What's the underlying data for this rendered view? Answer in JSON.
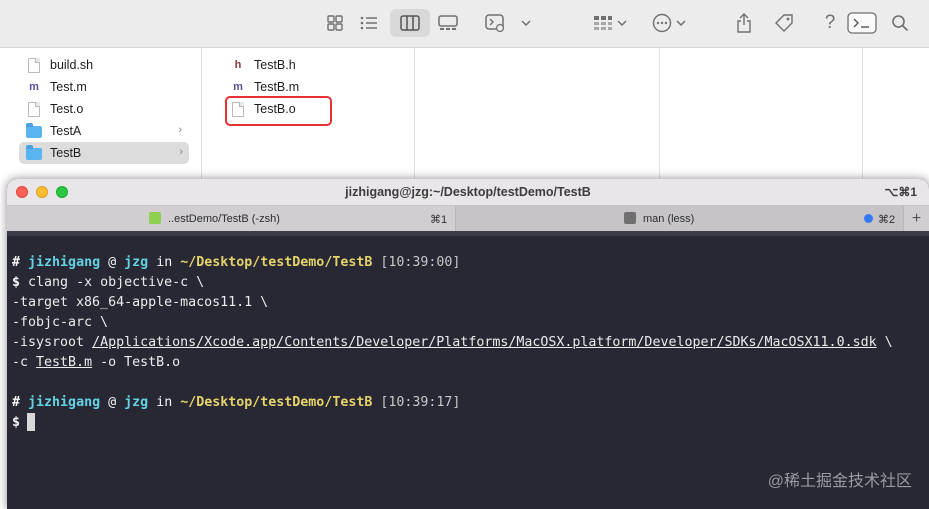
{
  "finder": {
    "column1": [
      {
        "name": "build.sh",
        "kind": "doc"
      },
      {
        "name": "Test.m",
        "kind": "m"
      },
      {
        "name": "Test.o",
        "kind": "doc"
      },
      {
        "name": "TestA",
        "kind": "folder"
      },
      {
        "name": "TestB",
        "kind": "folder",
        "selected": true
      }
    ],
    "column2": [
      {
        "name": "TestB.h",
        "kind": "h"
      },
      {
        "name": "TestB.m",
        "kind": "m"
      },
      {
        "name": "TestB.o",
        "kind": "doc",
        "highlighted": true
      }
    ],
    "glyphs": {
      "h": "h",
      "m": "m"
    },
    "colors": {
      "highlight_box": "#e8322f",
      "folder": "#5ab4f0"
    }
  },
  "terminal": {
    "title": "jizhigang@jzg:~/Desktop/testDemo/TestB",
    "window_shortcut": "⌥⌘1",
    "tabs": [
      {
        "label": "..estDemo/TestB (-zsh)",
        "shortcut": "⌘1",
        "icon": "terminal-icon",
        "active": true
      },
      {
        "label": "man (less)",
        "shortcut": "⌘2",
        "icon": "search-icon",
        "active": false
      }
    ],
    "add_tab": "+",
    "prompt1": {
      "hash": "#",
      "user": "jizhigang",
      "at": "@",
      "host": "jzg",
      "in": "in",
      "path": "~/Desktop/testDemo/TestB",
      "time": "[10:39:00]"
    },
    "command": {
      "line1_prefix": "$",
      "line1": "clang -x objective-c \\",
      "line2": "-target x86_64-apple-macos11.1 \\",
      "line3": "-fobjc-arc \\",
      "line4_prefix": "-isysroot ",
      "line4_path": "/Applications/Xcode.app/Contents/Developer/Platforms/MacOSX.platform/Developer/SDKs/MacOSX11.0.sdk",
      "line4_suffix": " \\",
      "line5_prefix": "-c ",
      "line5_file": "TestB.m",
      "line5_suffix": " -o TestB.o"
    },
    "prompt2": {
      "hash": "#",
      "user": "jizhigang",
      "at": "@",
      "host": "jzg",
      "in": "in",
      "path": "~/Desktop/testDemo/TestB",
      "time": "[10:39:17]"
    },
    "prompt3": {
      "prefix": "$"
    },
    "colors": {
      "background": "#272834",
      "user": "#f6f6f6",
      "host": "#63d2e3",
      "path": "#e5d36a"
    }
  },
  "watermark": "@稀土掘金技术社区"
}
